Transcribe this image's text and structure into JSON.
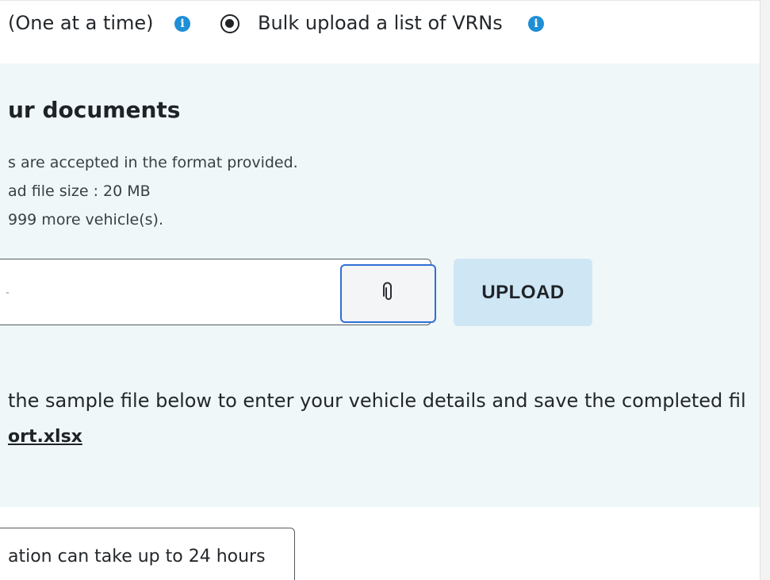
{
  "options": {
    "single_label": "(One at a time)",
    "bulk_label": "Bulk upload a list of VRNs",
    "info_icon": "info-icon",
    "selected": "bulk"
  },
  "documents": {
    "heading": "ur documents",
    "lines": [
      "s are accepted in the format provided.",
      "ad file size : 20 MB",
      "999 more vehicle(s)."
    ]
  },
  "upload": {
    "file_input_placeholder": "",
    "attach_icon": "paperclip-icon",
    "upload_label": "UPLOAD"
  },
  "sample": {
    "text": "the sample file below to enter your vehicle details and save the completed fil",
    "file_link": "ort.xlsx"
  },
  "notice": {
    "text": "ation can take up to 24 hours"
  },
  "colors": {
    "panel_bg": "#eff7f9",
    "accent": "#1e8fd6",
    "upload_button_bg": "#cfe6f4",
    "focus_border": "#2f6fd6"
  }
}
